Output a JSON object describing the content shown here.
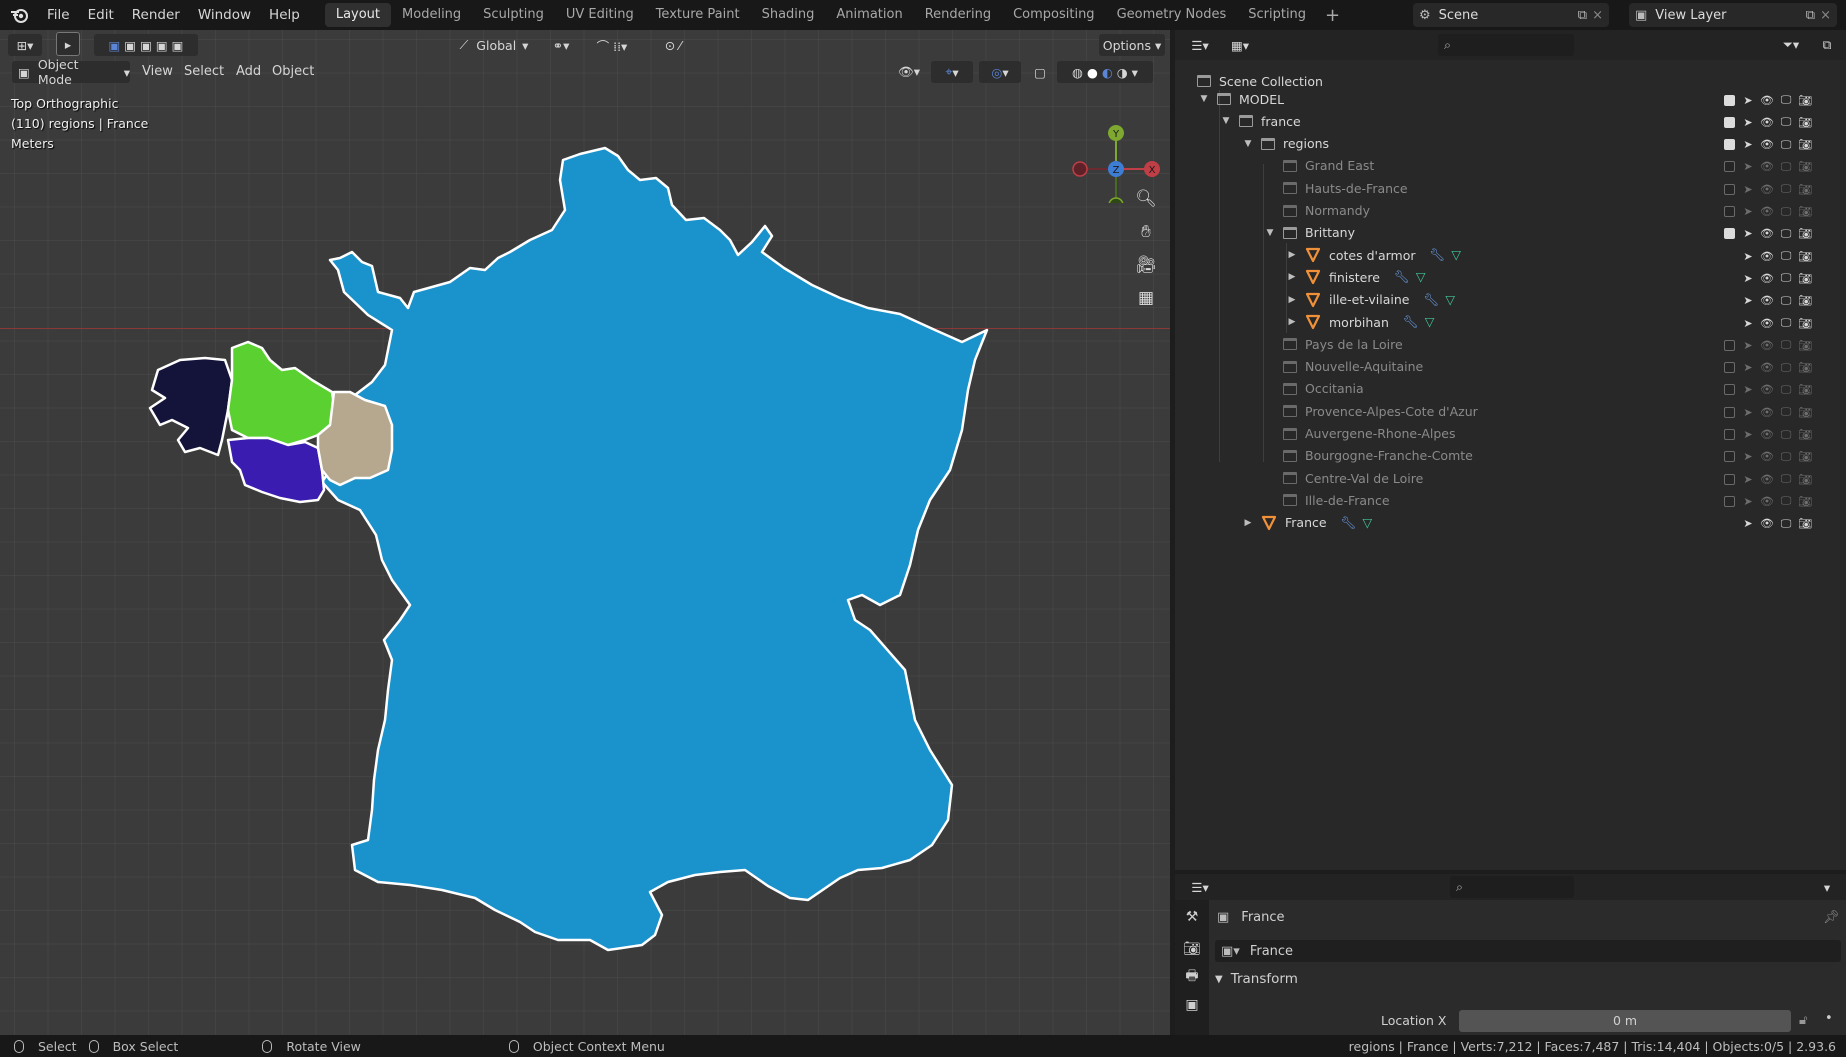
{
  "menu": [
    "File",
    "Edit",
    "Render",
    "Window",
    "Help"
  ],
  "workspaces": [
    "Layout",
    "Modeling",
    "Sculpting",
    "UV Editing",
    "Texture Paint",
    "Shading",
    "Animation",
    "Rendering",
    "Compositing",
    "Geometry Nodes",
    "Scripting"
  ],
  "active_workspace": "Layout",
  "scene": {
    "label": "Scene",
    "view_layer": "View Layer"
  },
  "viewport": {
    "transform_orientation": "Global",
    "options_label": "Options",
    "mode": "Object Mode",
    "menus": [
      "View",
      "Select",
      "Add",
      "Object"
    ],
    "view_name": "Top Orthographic",
    "collection_info": "(110) regions | France",
    "units": "Meters",
    "gizmo_axes": {
      "x": "X",
      "y": "Y",
      "z": "Z"
    },
    "colors": {
      "france": "#1a92cc",
      "finistere": "#14143a",
      "cotes_darmor": "#5ad130",
      "morbihan": "#3a1db0",
      "ille_et_vilaine": "#b6a88f",
      "outline": "#ffffff",
      "x_axis": "#8a3838"
    }
  },
  "outliner": {
    "root": "Scene Collection",
    "items": [
      {
        "label": "MODEL",
        "type": "collection",
        "depth": 0,
        "expanded": true,
        "checked": true,
        "dim": false
      },
      {
        "label": "france",
        "type": "collection",
        "depth": 1,
        "expanded": true,
        "checked": true,
        "dim": false
      },
      {
        "label": "regions",
        "type": "collection",
        "depth": 2,
        "expanded": true,
        "checked": true,
        "dim": false
      },
      {
        "label": "Grand East",
        "type": "collection",
        "depth": 3,
        "checked": false,
        "dim": true
      },
      {
        "label": "Hauts-de-France",
        "type": "collection",
        "depth": 3,
        "checked": false,
        "dim": true
      },
      {
        "label": "Normandy",
        "type": "collection",
        "depth": 3,
        "checked": false,
        "dim": true
      },
      {
        "label": "Brittany",
        "type": "collection",
        "depth": 3,
        "expanded": true,
        "checked": true,
        "dim": false
      },
      {
        "label": "cotes d'armor",
        "type": "mesh",
        "depth": 4,
        "collapsed": true,
        "dim": false
      },
      {
        "label": "finistere",
        "type": "mesh",
        "depth": 4,
        "collapsed": true,
        "dim": false
      },
      {
        "label": "ille-et-vilaine",
        "type": "mesh",
        "depth": 4,
        "collapsed": true,
        "dim": false
      },
      {
        "label": "morbihan",
        "type": "mesh",
        "depth": 4,
        "collapsed": true,
        "dim": false
      },
      {
        "label": "Pays de la Loire",
        "type": "collection",
        "depth": 3,
        "checked": false,
        "dim": true
      },
      {
        "label": "Nouvelle-Aquitaine",
        "type": "collection",
        "depth": 3,
        "checked": false,
        "dim": true
      },
      {
        "label": "Occitania",
        "type": "collection",
        "depth": 3,
        "checked": false,
        "dim": true
      },
      {
        "label": "Provence-Alpes-Cote d'Azur",
        "type": "collection",
        "depth": 3,
        "checked": false,
        "dim": true
      },
      {
        "label": "Auvergene-Rhone-Alpes",
        "type": "collection",
        "depth": 3,
        "checked": false,
        "dim": true
      },
      {
        "label": "Bourgogne-Franche-Comte",
        "type": "collection",
        "depth": 3,
        "checked": false,
        "dim": true
      },
      {
        "label": "Centre-Val de Loire",
        "type": "collection",
        "depth": 3,
        "checked": false,
        "dim": true
      },
      {
        "label": "Ille-de-France",
        "type": "collection",
        "depth": 3,
        "checked": false,
        "dim": true
      },
      {
        "label": "France",
        "type": "mesh",
        "depth": 2,
        "collapsed": true,
        "dim": false
      }
    ]
  },
  "properties": {
    "object_name": "France",
    "datablock_name": "France",
    "panel_title": "Transform",
    "location_x_label": "Location X",
    "location_x_value": "0 m"
  },
  "status": {
    "select": "Select",
    "box_select": "Box Select",
    "rotate_view": "Rotate View",
    "context_menu": "Object Context Menu",
    "stats": "regions | France | Verts:7,212 | Faces:7,487 | Tris:14,404 | Objects:0/5 | 2.93.6"
  }
}
